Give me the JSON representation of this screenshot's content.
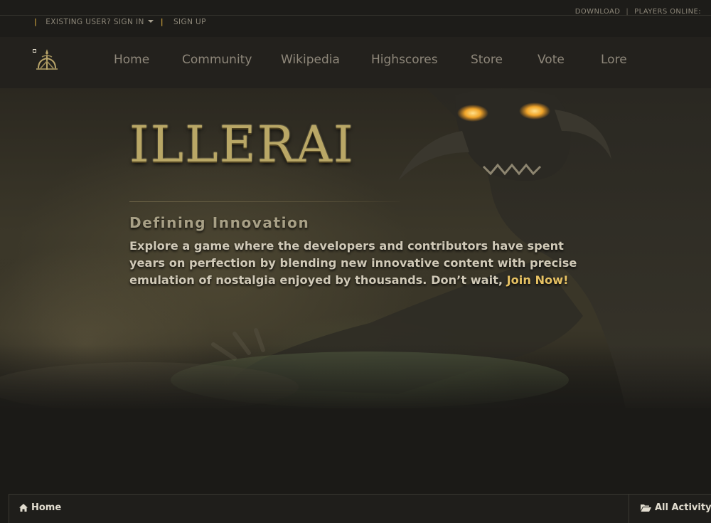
{
  "top_links": {
    "download": "DOWNLOAD",
    "separator": "|",
    "players_online": "PLAYERS ONLINE:",
    "sign_in": "EXISTING USER? SIGN IN",
    "sign_up": "SIGN UP",
    "pipe": "|"
  },
  "nav": {
    "logo_icon": "illerai-emblem-icon",
    "items": [
      {
        "label": "Home"
      },
      {
        "label": "Community"
      },
      {
        "label": "Wikipedia"
      },
      {
        "label": "Highscores"
      },
      {
        "label": "Store"
      },
      {
        "label": "Vote"
      },
      {
        "label": "Lore"
      }
    ]
  },
  "hero": {
    "title": "ILLERAI",
    "tagline": "Defining Innovation",
    "blurb": "Explore a game where the developers and contributors have spent years on perfection by blending new innovative content with precise emulation of nostalgia enjoyed by thousands. Don’t wait, ",
    "join_link": "Join Now!"
  },
  "breadcrumb": {
    "home_label": "Home",
    "home_icon": "home-icon",
    "activity_label": "All Activity",
    "activity_icon": "folder-open-icon"
  },
  "colors": {
    "background": "#1b1a17",
    "nav_background": "#23211d",
    "accent_gold": "#c29a3a",
    "join_link": "#e6c163",
    "title_gold": "#b9a766"
  }
}
